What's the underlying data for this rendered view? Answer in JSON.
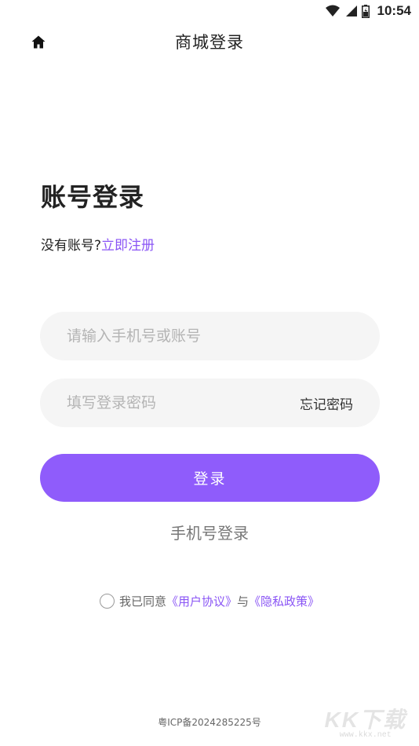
{
  "status_bar": {
    "time": "10:54",
    "icons": [
      "wifi-icon",
      "signal-icon",
      "battery-icon"
    ]
  },
  "nav": {
    "title": "商城登录",
    "home_icon": "home-icon"
  },
  "login": {
    "heading": "账号登录",
    "no_account_text": "没有账号?",
    "register_link": "立即注册",
    "account_placeholder": "请输入手机号或账号",
    "account_value": "",
    "password_placeholder": "填写登录密码",
    "password_value": "",
    "forgot_label": "忘记密码",
    "submit_label": "登录",
    "phone_login_label": "手机号登录"
  },
  "agreement": {
    "checked": false,
    "prefix": "我已同意",
    "user_agreement": "《用户协议》",
    "conjunction": "与",
    "privacy_policy": "《隐私政策》"
  },
  "footer": {
    "icp": "粤ICP备2024285225号"
  },
  "watermark": {
    "top": "KK下载",
    "bottom": "www.kkx.net"
  },
  "colors": {
    "accent": "#8f5cfb",
    "link": "#8a55f5",
    "field_bg": "#f5f5f5",
    "placeholder": "#b4b4b4"
  }
}
